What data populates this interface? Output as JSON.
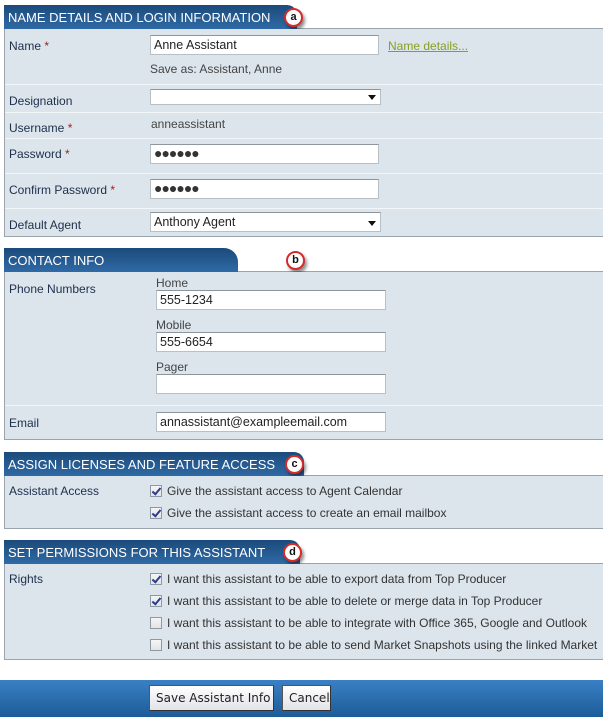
{
  "sections": {
    "name_login": {
      "title": "NAME DETAILS AND LOGIN INFORMATION",
      "badge": "a",
      "name_label": "Name",
      "name_value": "Anne Assistant",
      "name_details_link": "Name details...",
      "save_as": "Save as: Assistant, Anne",
      "designation_label": "Designation",
      "designation_value": "",
      "username_label": "Username",
      "username_value": "anneassistant",
      "password_label": "Password",
      "password_value": "●●●●●●",
      "confirm_password_label": "Confirm Password",
      "confirm_password_value": "●●●●●●",
      "default_agent_label": "Default Agent",
      "default_agent_value": "Anthony Agent",
      "required_marker": "*"
    },
    "contact": {
      "title": "CONTACT INFO",
      "badge": "b",
      "phone_label": "Phone Numbers",
      "home_label": "Home",
      "home_value": "555-1234",
      "mobile_label": "Mobile",
      "mobile_value": "555-6654",
      "pager_label": "Pager",
      "pager_value": "",
      "email_label": "Email",
      "email_value": "annassistant@exampleemail.com"
    },
    "licenses": {
      "title": "ASSIGN LICENSES AND FEATURE ACCESS",
      "badge": "c",
      "label": "Assistant Access",
      "options": [
        {
          "text": "Give the assistant access to Agent Calendar",
          "checked": true
        },
        {
          "text": "Give the assistant access to create an email mailbox",
          "checked": true
        }
      ]
    },
    "permissions": {
      "title": "SET PERMISSIONS FOR THIS ASSISTANT",
      "badge": "d",
      "label": "Rights",
      "options": [
        {
          "text": "I want this assistant to be able to export data from Top Producer",
          "checked": true
        },
        {
          "text": "I want this assistant to be able to delete or merge data in Top Producer",
          "checked": true
        },
        {
          "text": "I want this assistant to be able to integrate with Office 365, Google and Outlook",
          "checked": false
        },
        {
          "text": "I want this assistant to be able to send Market Snapshots using the linked Market",
          "checked": false
        }
      ]
    }
  },
  "footer": {
    "save_label": "Save Assistant Info",
    "cancel_label": "Cancel"
  }
}
